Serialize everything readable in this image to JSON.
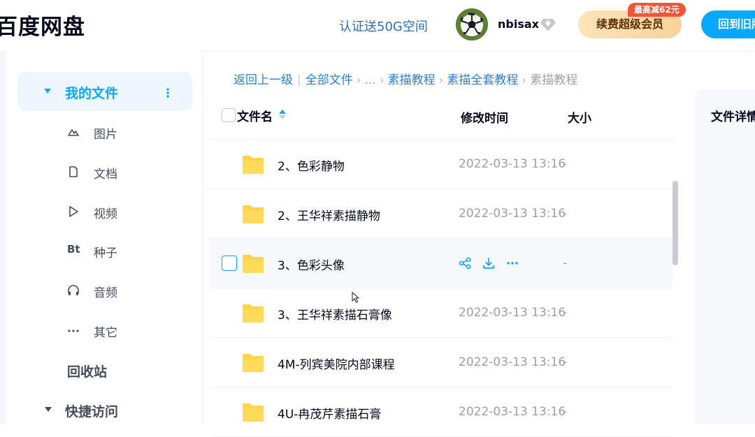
{
  "header": {
    "logo_prefix": "百",
    "logo_rest": "度网盘",
    "verify_link": "认证送50G空间",
    "username": "nbisax",
    "renew_button": "续费超级会员",
    "discount_badge": "最高减62元",
    "old_version_button": "回到旧版"
  },
  "sidebar": {
    "my_files": "我的文件",
    "items": [
      {
        "label": "图片",
        "icon": "image-icon"
      },
      {
        "label": "文档",
        "icon": "document-icon"
      },
      {
        "label": "视频",
        "icon": "video-icon"
      },
      {
        "label": "种子",
        "icon": "bt-icon"
      },
      {
        "label": "音频",
        "icon": "headphones-icon"
      },
      {
        "label": "其它",
        "icon": "more-icon"
      }
    ],
    "recycle": "回收站",
    "quick_access": "快捷访问"
  },
  "breadcrumb": {
    "back": "返回上一级",
    "all_files": "全部文件",
    "ellipsis": "...",
    "path1": "素描教程",
    "path2": "素描全套教程",
    "current": "素描教程"
  },
  "list": {
    "col_name": "文件名",
    "col_time": "修改时间",
    "col_size": "大小",
    "rows": [
      {
        "name": "2、色彩静物",
        "time": "2022-03-13 13:16",
        "size": "-"
      },
      {
        "name": "2、王华祥素描静物",
        "time": "2022-03-13 13:16",
        "size": "-"
      },
      {
        "name": "3、色彩头像",
        "time": "",
        "size": "-"
      },
      {
        "name": "3、王华祥素描石膏像",
        "time": "2022-03-13 13:16",
        "size": "-"
      },
      {
        "name": "4M-列宾美院内部课程",
        "time": "2022-03-13 13:16",
        "size": "-"
      },
      {
        "name": "4U-冉茂芹素描石膏",
        "time": "2022-03-13 13:16",
        "size": "-"
      }
    ]
  },
  "detail": {
    "title": "文件详情"
  },
  "colors": {
    "accent": "#06a7ff",
    "folder": "#ffd449"
  }
}
